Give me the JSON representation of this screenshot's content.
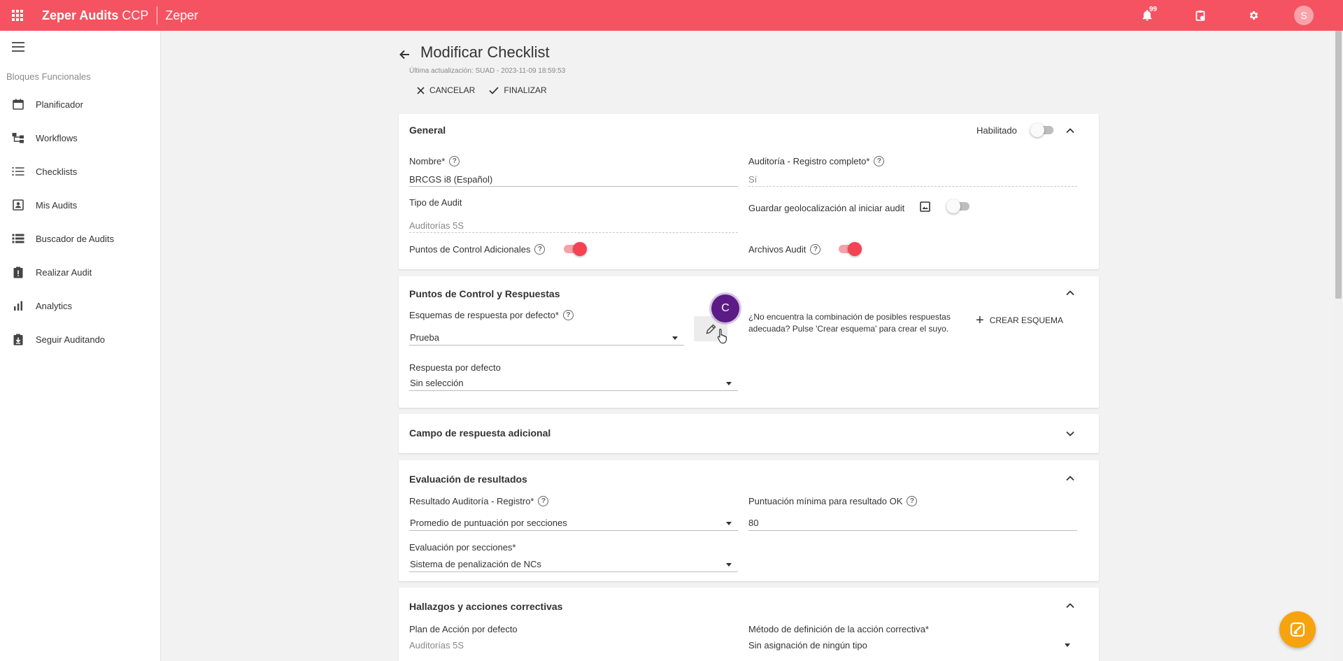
{
  "topbar": {
    "app_name_bold": "Zeper Audits",
    "app_name_light": "CCP",
    "org": "Zeper",
    "notifications_count": "99",
    "avatar_letter": "S",
    "icons": [
      "apps-grid-icon",
      "bell-icon",
      "clipboard-icon",
      "gear-icon"
    ]
  },
  "sidebar": {
    "heading": "Bloques Funcionales",
    "items": [
      {
        "label": "Planificador",
        "icon": "calendar-icon"
      },
      {
        "label": "Workflows",
        "icon": "workflow-icon"
      },
      {
        "label": "Checklists",
        "icon": "list-icon"
      },
      {
        "label": "Mis Audits",
        "icon": "contact-card-icon"
      },
      {
        "label": "Buscador de Audits",
        "icon": "list-search-icon"
      },
      {
        "label": "Realizar Audit",
        "icon": "clipboard-alert-icon"
      },
      {
        "label": "Analytics",
        "icon": "bar-chart-icon"
      },
      {
        "label": "Seguir Auditando",
        "icon": "clipboard-download-icon"
      }
    ]
  },
  "page": {
    "title": "Modificar Checklist",
    "last_update": "Última actualización: SUAD - 2023-11-09 18:59:53",
    "cancel_label": "CANCELAR",
    "finish_label": "FINALIZAR"
  },
  "general": {
    "title": "General",
    "enabled_label": "Habilitado",
    "enabled": false,
    "name_label": "Nombre*",
    "name_value": "BRCGS i8 (Español)",
    "audit_record_label": "Auditoría - Registro completo*",
    "audit_record_value": "Sí",
    "audit_type_label": "Tipo de Audit",
    "audit_type_value": "Auditorías 5S",
    "geo_label": "Guardar geolocalización al iniciar audit",
    "geo_enabled": false,
    "extra_points_label": "Puntos de Control Adicionales",
    "extra_points_enabled": true,
    "files_label": "Archivos Audit",
    "files_enabled": true
  },
  "control_points": {
    "title": "Puntos de Control y Respuestas",
    "schema_label": "Esquemas de respuesta por defecto*",
    "schema_value": "Prueba",
    "default_answer_label": "Respuesta por defecto",
    "default_answer_value": "Sin selección",
    "help_text": "¿No encuentra la combinación de posibles respuestas adecuada? Pulse 'Crear esquema' para crear el suyo.",
    "create_label": "CREAR ESQUEMA",
    "cursor_marker": "C"
  },
  "extra_field": {
    "title": "Campo de respuesta adicional"
  },
  "evaluation": {
    "title": "Evaluación de resultados",
    "result_label": "Resultado Auditoría - Registro*",
    "result_value": "Promedio de puntuación por secciones",
    "min_score_label": "Puntuación mínima para resultado OK",
    "min_score_value": "80",
    "sections_label": "Evaluación por secciones*",
    "sections_value": "Sistema de penalización de NCs"
  },
  "findings": {
    "title": "Hallazgos y acciones correctivas",
    "plan_label": "Plan de Acción por defecto",
    "plan_value": "Auditorías 5S",
    "method_label": "Método de definición de la acción correctiva*",
    "method_value": "Sin asignación de ningún tipo"
  },
  "colors": {
    "brand": "#f55361",
    "toggle_on": "#f44352",
    "marker": "#5c1b86",
    "fab": "#f6a30e"
  }
}
